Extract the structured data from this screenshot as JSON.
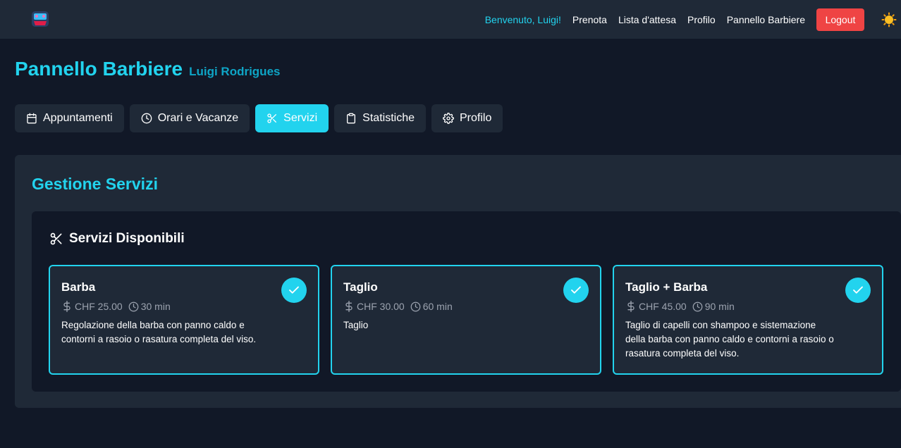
{
  "nav": {
    "welcome": "Benvenuto, Luigi!",
    "links": [
      "Prenota",
      "Lista d'attesa",
      "Profilo",
      "Pannello Barbiere"
    ],
    "logout": "Logout"
  },
  "header": {
    "title": "Pannello Barbiere",
    "subtitle": "Luigi Rodrigues"
  },
  "tabs": [
    {
      "label": "Appuntamenti",
      "icon": "calendar-icon"
    },
    {
      "label": "Orari e Vacanze",
      "icon": "clock-icon"
    },
    {
      "label": "Servizi",
      "icon": "scissors-icon",
      "active": true
    },
    {
      "label": "Statistiche",
      "icon": "clipboard-icon"
    },
    {
      "label": "Profilo",
      "icon": "gear-icon"
    }
  ],
  "panel": {
    "title": "Gestione Servizi",
    "section_title": "Servizi Disponibili"
  },
  "services": [
    {
      "name": "Barba",
      "price": "CHF 25.00",
      "duration": "30 min",
      "description": "Regolazione della barba con panno caldo e contorni a rasoio o rasatura completa del viso.",
      "selected": true
    },
    {
      "name": "Taglio",
      "price": "CHF 30.00",
      "duration": "60 min",
      "description": "Taglio",
      "selected": true
    },
    {
      "name": "Taglio + Barba",
      "price": "CHF 45.00",
      "duration": "90 min",
      "description": "Taglio di capelli con shampoo e sistemazione della barba con panno caldo e contorni a rasoio o rasatura completa del viso.",
      "selected": true
    }
  ],
  "colors": {
    "accent": "#22d3ee",
    "background": "#111827",
    "surface": "#1f2937",
    "logout": "#ef4444"
  }
}
